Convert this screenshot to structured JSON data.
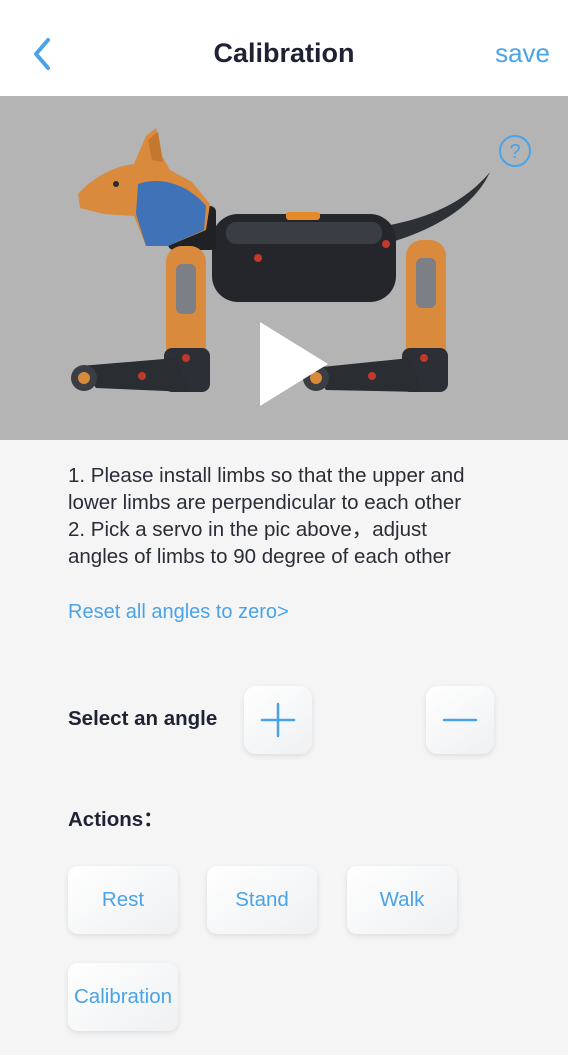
{
  "header": {
    "title": "Calibration",
    "save_label": "save",
    "back_icon": "chevron-left-icon"
  },
  "media": {
    "play_icon": "play-icon",
    "help_icon": "question-circle-icon"
  },
  "instructions": {
    "lines": [
      "1. Please install limbs so that the upper and",
      "lower limbs are perpendicular to each other",
      "2. Pick a servo in the pic above，adjust",
      "angles of limbs to 90 degree of each other"
    ]
  },
  "reset_link": "Reset all angles to zero>",
  "angle": {
    "label": "Select an angle",
    "plus_icon": "plus-icon",
    "minus_icon": "minus-icon"
  },
  "actions": {
    "label": "Actions：",
    "buttons": [
      "Rest",
      "Stand",
      "Walk",
      "Calibration"
    ]
  },
  "colors": {
    "accent": "#4aa3e8",
    "text_dark": "#1f2233",
    "background": "#f5f5f5",
    "media_bg": "#b4b4b4"
  }
}
